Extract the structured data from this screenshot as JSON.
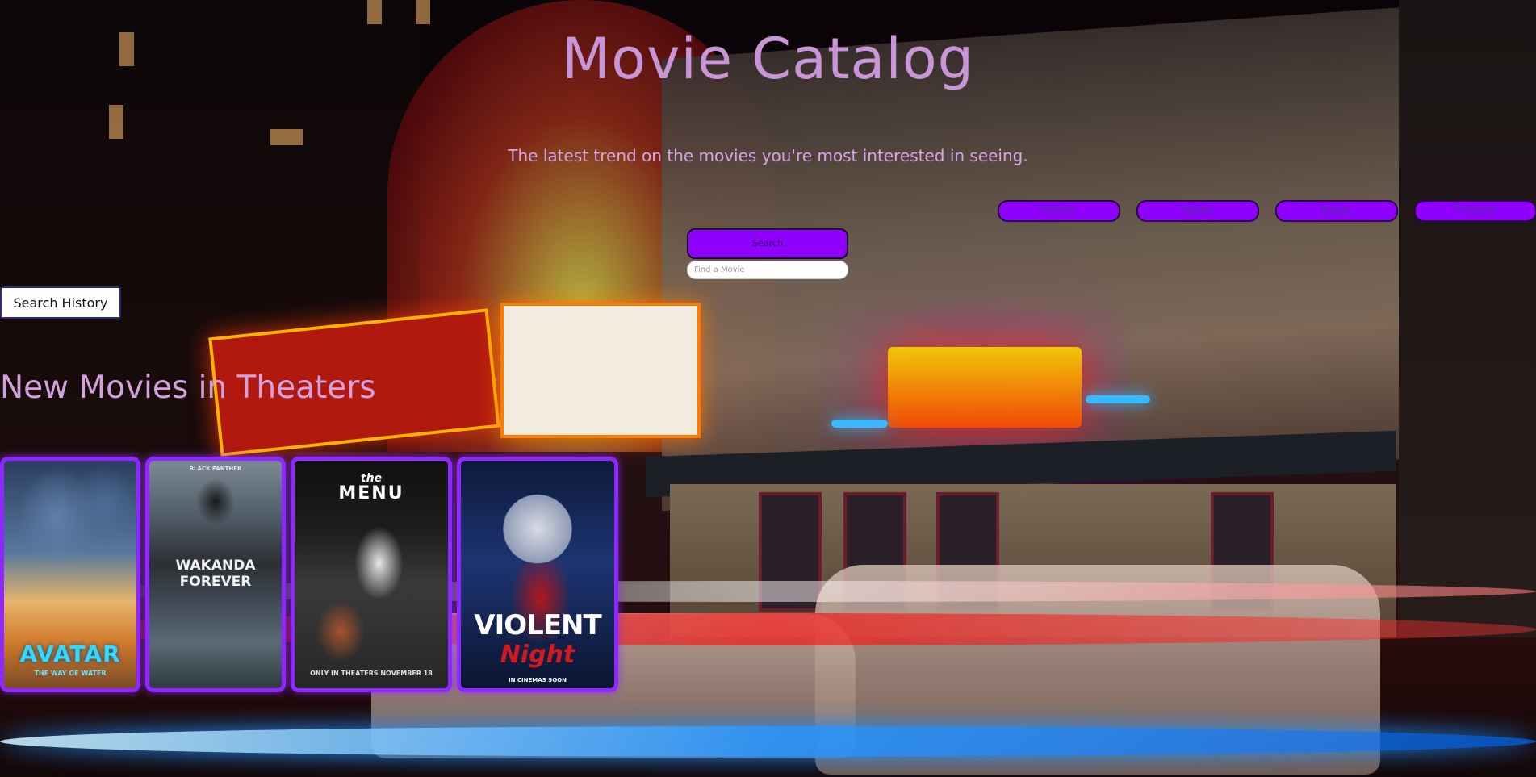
{
  "header": {
    "title": "Movie Catalog",
    "subtitle": "The latest trend on the movies you're most interested in seeing."
  },
  "nav": {
    "items": [
      {
        "label": "Home"
      },
      {
        "label": "News"
      },
      {
        "label": "Blogs"
      },
      {
        "label": "Theater"
      }
    ]
  },
  "search": {
    "button_label": "Search",
    "placeholder": "Find a Movie",
    "value": ""
  },
  "history": {
    "button_label": "Search History"
  },
  "section": {
    "title": "New Movies in Theaters"
  },
  "posters": [
    {
      "title": "AVATAR",
      "subtitle": "THE WAY OF WATER"
    },
    {
      "top": "BLACK PANTHER",
      "title": "WAKANDA FOREVER"
    },
    {
      "top": "the",
      "title": "MENU",
      "bottom": "ONLY IN THEATERS NOVEMBER 18"
    },
    {
      "title": "VIOLENT",
      "subtitle": "Night",
      "bottom": "IN CINEMAS SOON"
    }
  ],
  "colors": {
    "accent": "#8f00ff",
    "title": "#c895d6",
    "poster_border": "#8f28ff"
  }
}
